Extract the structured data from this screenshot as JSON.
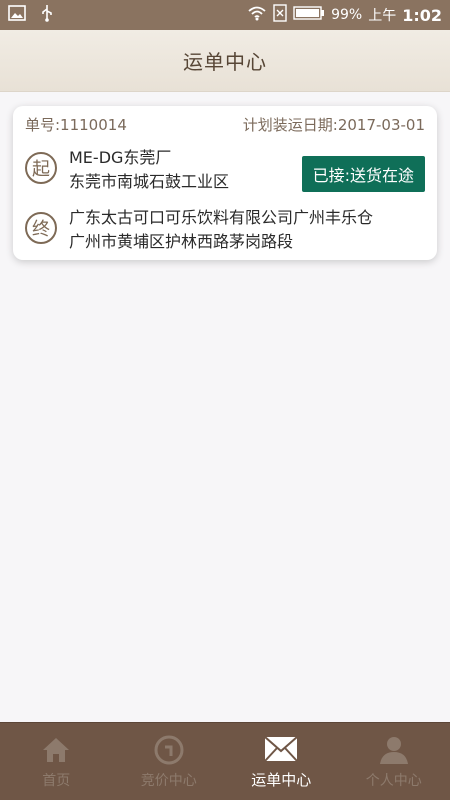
{
  "status_bar": {
    "battery_percent": "99%",
    "time_prefix": "上午",
    "time": "1:02"
  },
  "header": {
    "title": "运单中心"
  },
  "order": {
    "number_label": "单号:1110014",
    "planned_date_label": "计划装运日期:2017-03-01",
    "start_marker": "起",
    "end_marker": "终",
    "start_name": "ME-DG东莞厂",
    "start_address": "东莞市南城石鼓工业区",
    "end_name": "广东太古可口可乐饮料有限公司广州丰乐仓",
    "end_address": "广州市黄埔区护林西路茅岗路段",
    "status_label": "已接:送货在途"
  },
  "tabs": [
    {
      "label": "首页",
      "icon": "home-icon"
    },
    {
      "label": "竞价中心",
      "icon": "bid-icon"
    },
    {
      "label": "运单中心",
      "icon": "mail-icon",
      "active": true
    },
    {
      "label": "个人中心",
      "icon": "user-icon"
    }
  ],
  "colors": {
    "status_bar": "#8a7360",
    "accent_green": "#0f6f58",
    "tab_bar": "#6f5646",
    "marker": "#7e6a56"
  }
}
